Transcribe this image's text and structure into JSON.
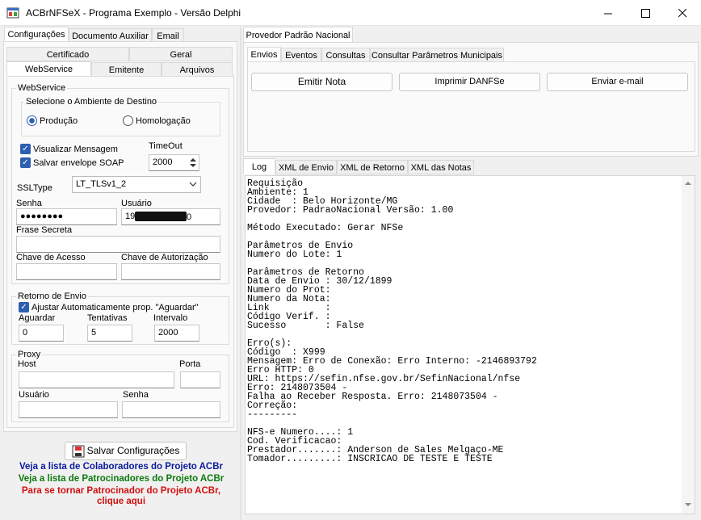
{
  "window": {
    "title": "ACBrNFSeX - Programa Exemplo - Versão Delphi"
  },
  "left": {
    "top_tabs": [
      "Configurações",
      "Documento Auxiliar",
      "Email"
    ],
    "tabs_row1": [
      "Certificado",
      "Geral"
    ],
    "tabs_row2": [
      "WebService",
      "Emitente",
      "Arquivos"
    ],
    "webservice": {
      "group_label": "WebService",
      "ambiente_label": "Selecione o Ambiente de Destino",
      "radio_producao": "Produção",
      "radio_homologacao": "Homologação",
      "visualizar": "Visualizar Mensagem",
      "salvar_envelope": "Salvar envelope SOAP",
      "timeout_label": "TimeOut",
      "timeout_value": "2000",
      "ssltype_label": "SSLType",
      "ssltype_value": "LT_TLSv1_2",
      "senha_label": "Senha",
      "senha_value": "●●●●●●●●",
      "usuario_label": "Usuário",
      "usuario_value": "19",
      "usuario_tail": "0",
      "frase_label": "Frase Secreta",
      "chave_acesso_label": "Chave de Acesso",
      "chave_aut_label": "Chave de Autorização"
    },
    "retorno": {
      "group_label": "Retorno de Envio",
      "ajustar": "Ajustar Automaticamente prop. \"Aguardar\"",
      "aguardar_label": "Aguardar",
      "aguardar_value": "0",
      "tentativas_label": "Tentativas",
      "tentativas_value": "5",
      "intervalo_label": "Intervalo",
      "intervalo_value": "2000"
    },
    "proxy": {
      "group_label": "Proxy",
      "host_label": "Host",
      "porta_label": "Porta",
      "usuario_label": "Usuário",
      "senha_label": "Senha"
    },
    "salvar_button": "Salvar Configurações",
    "links": {
      "colaboradores": "Veja a lista de Colaboradores do Projeto ACBr",
      "patrocinadores": "Veja a lista de Patrocinadores do Projeto ACBr",
      "tornar_1": "Para se tornar Patrocinador do Projeto ACBr,",
      "tornar_2": "clique aqui"
    },
    "colors": {
      "blue": "#0a1a9c",
      "green": "#0d7a0d",
      "red": "#d01010"
    }
  },
  "right": {
    "provider_tab": "Provedor Padrão Nacional",
    "action_tabs": [
      "Envios",
      "Eventos",
      "Consultas",
      "Consultar Parâmetros Municipais"
    ],
    "buttons": {
      "emitir": "Emitir Nota",
      "imprimir": "Imprimir DANFSe",
      "email": "Enviar e-mail"
    },
    "log_tabs": [
      "Log",
      "XML de Envio",
      "XML de Retorno",
      "XML das Notas"
    ],
    "log_text": "Requisição\nAmbiente: 1\nCidade  : Belo Horizonte/MG\nProvedor: PadraoNacional Versão: 1.00\n\nMétodo Executado: Gerar NFSe\n\nParâmetros de Envio\nNumero do Lote: 1\n\nParâmetros de Retorno\nData de Envio : 30/12/1899\nNumero do Prot:\nNumero da Nota:\nLink          :\nCódigo Verif. :\nSucesso       : False\n\nErro(s):\nCódigo  : X999\nMensagem: Erro de Conexão: Erro Interno: -2146893792\nErro HTTP: 0\nURL: https://sefin.nfse.gov.br/SefinNacional/nfse\nErro: 2148073504 -\nFalha ao Receber Resposta. Erro: 2148073504 -\nCorreção:\n---------\n\nNFS-e Numero....: 1\nCod. Verificacao:\nPrestador.......: Anderson de Sales Melgaço-ME\nTomador.........: INSCRICAO DE TESTE E TESTE"
  }
}
